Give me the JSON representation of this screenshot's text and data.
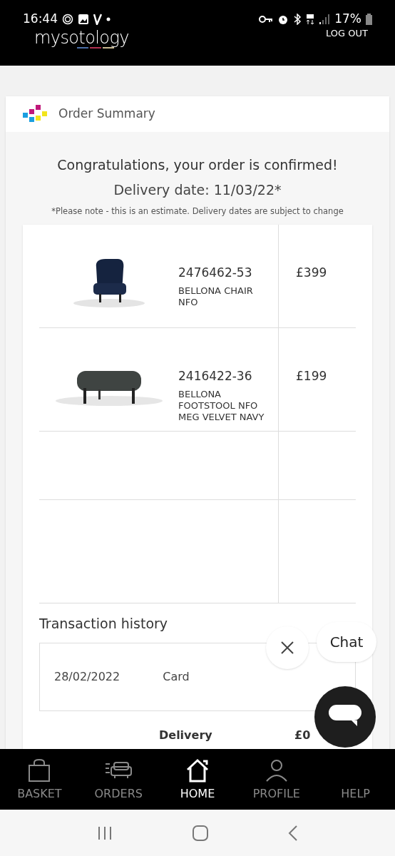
{
  "status_bar": {
    "time": "16:44",
    "battery": "17%"
  },
  "header": {
    "logo": "mysotology",
    "logout": "LOG OUT"
  },
  "card": {
    "title": "Order Summary"
  },
  "confirmation": {
    "heading": "Congratulations, your order is confirmed!",
    "delivery_date": "Delivery date: 11/03/22*",
    "note": "*Please note - this is an estimate. Delivery dates are subject to change"
  },
  "items": [
    {
      "kind": "chair",
      "code": "2476462-53",
      "name": "BELLONA CHAIR NFO",
      "price": "£399"
    },
    {
      "kind": "footstool",
      "code": "2416422-36",
      "name": "BELLONA FOOTSTOOL NFO MEG VELVET NAVY",
      "price": "£199"
    },
    {
      "kind": "empty"
    },
    {
      "kind": "empty"
    }
  ],
  "transaction_history": {
    "title": "Transaction history",
    "rows": [
      {
        "date": "28/02/2022",
        "method": "Card"
      }
    ]
  },
  "summary": [
    {
      "label": "Delivery",
      "value": "£0"
    }
  ],
  "chat": {
    "label": "Chat"
  },
  "bottom_nav": [
    {
      "label": "BASKET",
      "selected": false
    },
    {
      "label": "ORDERS",
      "selected": false
    },
    {
      "label": "HOME",
      "selected": true
    },
    {
      "label": "PROFILE",
      "selected": false
    },
    {
      "label": "HELP",
      "selected": false
    }
  ]
}
